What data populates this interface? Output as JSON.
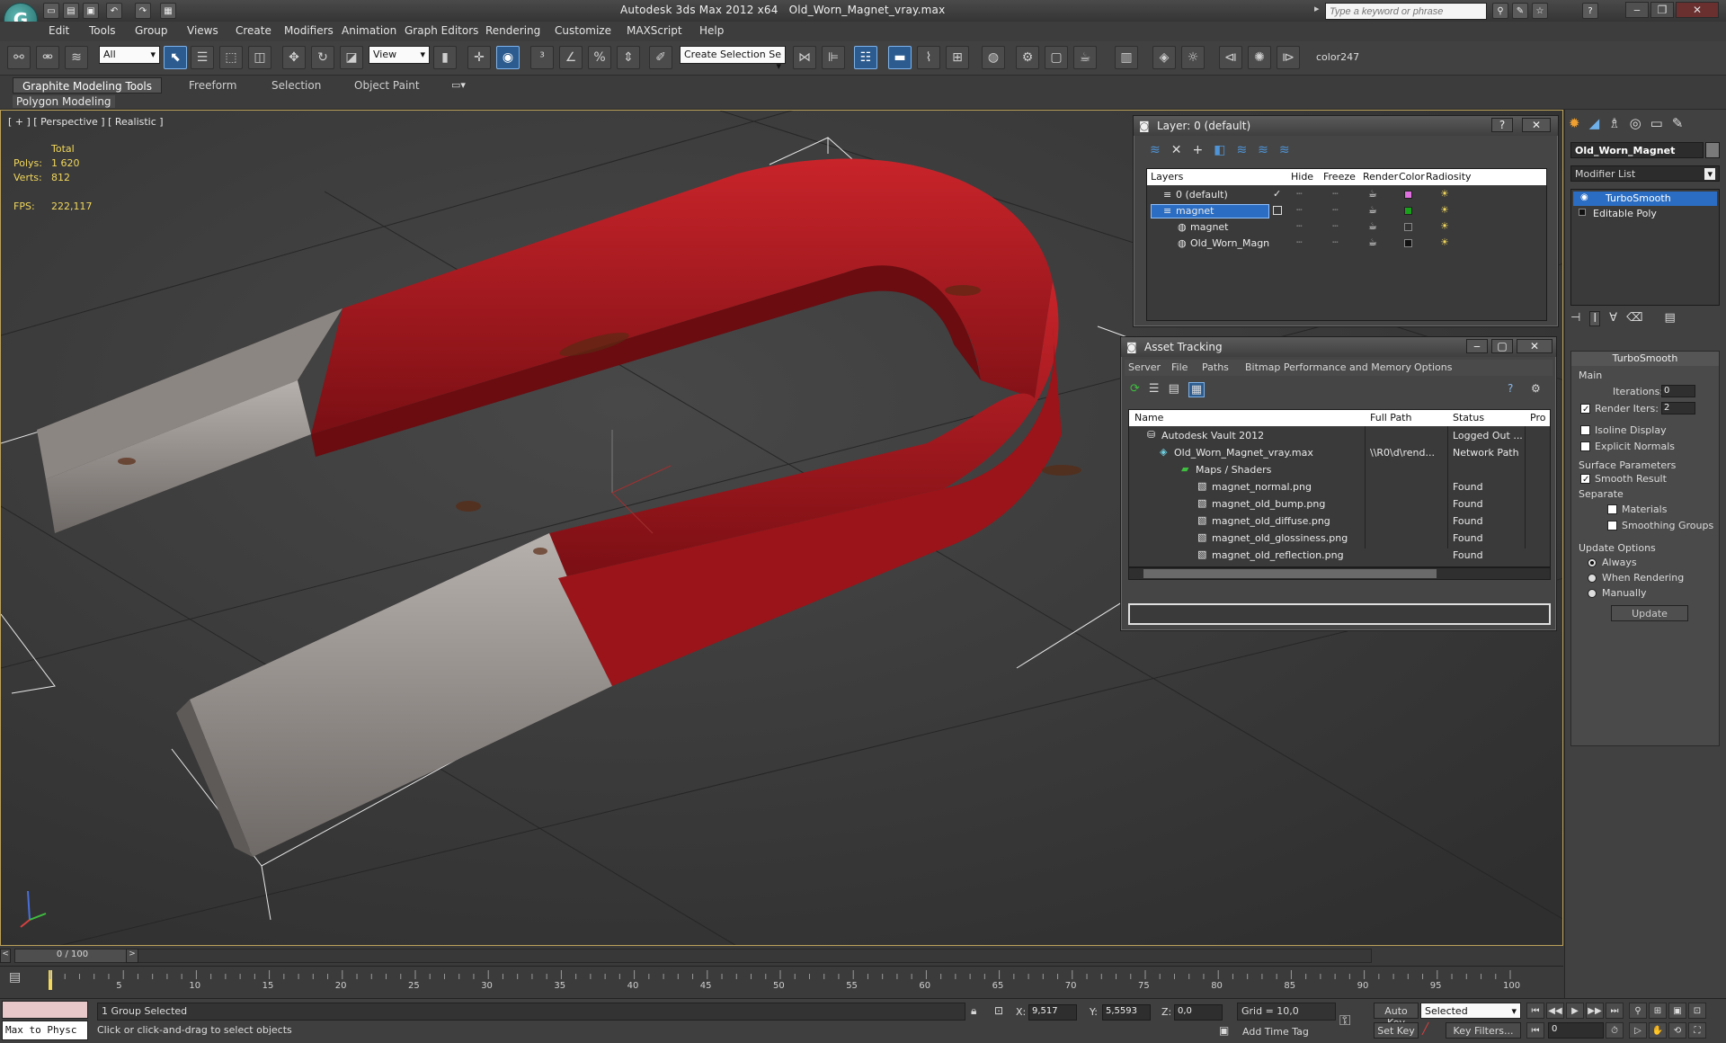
{
  "app": {
    "title_app": "Autodesk 3ds Max  2012 x64",
    "title_file": "Old_Worn_Magnet_vray.max",
    "search_placeholder": "Type a keyword or phrase",
    "logo_glyph": "G"
  },
  "menu": [
    "Edit",
    "Tools",
    "Group",
    "Views",
    "Create",
    "Modifiers",
    "Animation",
    "Graph Editors",
    "Rendering",
    "Customize",
    "MAXScript",
    "Help"
  ],
  "toolbar": {
    "selection_filter": "All",
    "ref_coord": "View",
    "named_selection": "Create Selection Se",
    "color_label": "color247"
  },
  "ribbon": {
    "tabs": [
      "Graphite Modeling Tools",
      "Freeform",
      "Selection",
      "Object Paint"
    ],
    "sub_label": "Polygon Modeling"
  },
  "viewport": {
    "label": "[ + ] [ Perspective ] [ Realistic ]",
    "stats_header": "Total",
    "polys_label": "Polys:",
    "polys_value": "1 620",
    "verts_label": "Verts:",
    "verts_value": "812",
    "fps_label": "FPS:",
    "fps_value": "222,117"
  },
  "layer_dialog": {
    "title": "Layer: 0 (default)",
    "columns": [
      "Layers",
      "Hide",
      "Freeze",
      "Render",
      "Color",
      "Radiosity"
    ],
    "rows": [
      {
        "name": "0 (default)",
        "color": "#e070e0",
        "indent": 1
      },
      {
        "name": "magnet",
        "color": "#1aa01a",
        "indent": 1
      },
      {
        "name": "magnet",
        "color": "#333333",
        "indent": 2
      },
      {
        "name": "Old_Worn_Magn",
        "color": "#111111",
        "indent": 2
      }
    ]
  },
  "asset_dialog": {
    "title": "Asset Tracking",
    "menu": [
      "Server",
      "File",
      "Paths",
      "Bitmap Performance and Memory",
      "Options"
    ],
    "columns": [
      "Name",
      "Full Path",
      "Status",
      "Pro"
    ],
    "rows": [
      {
        "name": "Autodesk Vault 2012",
        "path": "",
        "status": "Logged Out ...",
        "indent": 0
      },
      {
        "name": "Old_Worn_Magnet_vray.max",
        "path": "\\\\R0\\d\\rend...",
        "status": "Network Path",
        "indent": 1
      },
      {
        "name": "Maps / Shaders",
        "path": "",
        "status": "",
        "indent": 2
      },
      {
        "name": "magnet_normal.png",
        "path": "",
        "status": "Found",
        "indent": 3
      },
      {
        "name": "magnet_old_bump.png",
        "path": "",
        "status": "Found",
        "indent": 3
      },
      {
        "name": "magnet_old_diffuse.png",
        "path": "",
        "status": "Found",
        "indent": 3
      },
      {
        "name": "magnet_old_glossiness.png",
        "path": "",
        "status": "Found",
        "indent": 3
      },
      {
        "name": "magnet_old_reflection.png",
        "path": "",
        "status": "Found",
        "indent": 3
      }
    ]
  },
  "cmd_panel": {
    "object_name": "Old_Worn_Magnet",
    "modifier_list": "Modifier List",
    "stack": [
      "TurboSmooth",
      "Editable Poly"
    ],
    "rollout_title": "TurboSmooth",
    "main_label": "Main",
    "iterations_label": "Iterations:",
    "iterations_value": "0",
    "render_iters_label": "Render Iters:",
    "render_iters_value": "2",
    "isoline": "Isoline Display",
    "explicit": "Explicit Normals",
    "surface_params": "Surface Parameters",
    "smooth_result": "Smooth Result",
    "separate": "Separate",
    "materials": "Materials",
    "smoothing_groups": "Smoothing Groups",
    "update_options": "Update Options",
    "always": "Always",
    "when_rendering": "When Rendering",
    "manually": "Manually",
    "update_btn": "Update"
  },
  "timeline": {
    "frame": "0 / 100",
    "ticks": [
      "5",
      "10",
      "15",
      "20",
      "25",
      "30",
      "35",
      "40",
      "45",
      "50",
      "55",
      "60",
      "65",
      "70",
      "75",
      "80",
      "85",
      "90",
      "95",
      "100"
    ]
  },
  "status": {
    "maxscript": "Max to Physc",
    "selection": "1 Group Selected",
    "prompt": "Click or click-and-drag to select objects",
    "x_label": "X:",
    "x_value": "9,517",
    "y_label": "Y:",
    "y_value": "5,5593",
    "z_label": "Z:",
    "z_value": "0,0",
    "grid": "Grid = 10,0",
    "add_time_tag": "Add Time Tag",
    "auto_key": "Auto Key",
    "set_key": "Set Key",
    "key_mode": "Selected",
    "key_filters": "Key Filters...",
    "frame_value": "0"
  }
}
